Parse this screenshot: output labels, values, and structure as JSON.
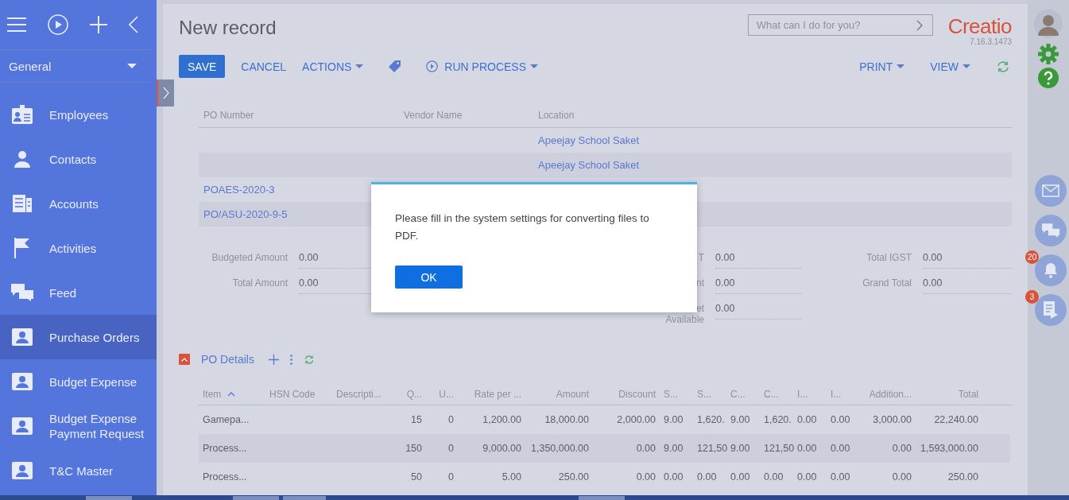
{
  "sidebar": {
    "section": "General",
    "items": [
      {
        "label": "Employees",
        "kind": "badge",
        "selected": false
      },
      {
        "label": "Contacts",
        "kind": "person",
        "selected": false
      },
      {
        "label": "Accounts",
        "kind": "building",
        "selected": false
      },
      {
        "label": "Activities",
        "kind": "flag",
        "selected": false
      },
      {
        "label": "Feed",
        "kind": "chat",
        "selected": false
      },
      {
        "label": "Purchase Orders",
        "kind": "card",
        "selected": true
      },
      {
        "label": "Budget Expense",
        "kind": "card",
        "selected": false
      },
      {
        "label": "Budget Expense Payment Request",
        "kind": "card",
        "selected": false
      },
      {
        "label": "T&C Master",
        "kind": "card",
        "selected": false
      }
    ]
  },
  "page": {
    "title": "New record",
    "search": {
      "placeholder": "What can I do for you?"
    },
    "logo": "Creatio",
    "version": "7.16.3.1473"
  },
  "toolbar": {
    "left": [
      {
        "label": "SAVE",
        "kind": "primary"
      },
      {
        "label": "CANCEL",
        "kind": "link"
      },
      {
        "label": "ACTIONS",
        "kind": "menu"
      },
      {
        "kind": "tag"
      },
      {
        "label": "RUN PROCESS",
        "kind": "process"
      }
    ],
    "right": [
      {
        "label": "PRINT",
        "kind": "menu"
      },
      {
        "label": "VIEW",
        "kind": "menu"
      },
      {
        "kind": "refresh"
      }
    ]
  },
  "records": {
    "columns": [
      "PO Number",
      "Vendor Name",
      "Location"
    ],
    "rows": [
      {
        "location": "Apeejay School Saket"
      },
      {
        "location": "Apeejay School Saket"
      },
      {
        "po_number": "POAES-2020-3"
      },
      {
        "po_number": "PO/ASU-2020-9-5"
      }
    ]
  },
  "fields": [
    [
      {
        "label": "Budgeted Amount",
        "value": "0.00"
      },
      {
        "label": "Total Amount",
        "value": "0.00"
      }
    ],
    [
      {
        "label": "T",
        "value": "0.00"
      },
      {
        "label": "nt",
        "value": "0.00"
      },
      {
        "label": "et\nAvailable",
        "value": "0.00"
      }
    ],
    [
      {
        "label": "Total IGST",
        "value": "0.00"
      },
      {
        "label": "Grand Total",
        "value": "0.00"
      }
    ]
  ],
  "details": {
    "title": "PO Details",
    "expanded": true,
    "columns": [
      {
        "label": "Item",
        "sorted": true
      },
      {
        "label": "HSN Code",
        "sorted": false
      },
      {
        "label": "Descripti...",
        "sorted": false
      },
      {
        "label": "Q...",
        "sorted": false
      },
      {
        "label": "U...",
        "sorted": false
      },
      {
        "label": "Rate per ...",
        "sorted": false
      },
      {
        "label": "Amount",
        "sorted": false
      },
      {
        "label": "Discount",
        "sorted": false
      },
      {
        "label": "S...",
        "sorted": false
      },
      {
        "label": "S...",
        "sorted": false
      },
      {
        "label": "C...",
        "sorted": false
      },
      {
        "label": "C...",
        "sorted": false
      },
      {
        "label": "I...",
        "sorted": false
      },
      {
        "label": "I...",
        "sorted": false
      },
      {
        "label": "Addition...",
        "sorted": false
      },
      {
        "label": "Total",
        "sorted": false
      }
    ],
    "rows": [
      [
        "Gamepa...",
        "",
        "",
        "15",
        "0",
        "1,200.00",
        "18,000.00",
        "2,000.00",
        "9.00",
        "1,620.",
        "9.00",
        "1,620.",
        "0.00",
        "0.00",
        "3,000.00",
        "22,240.00"
      ],
      [
        "Process...",
        "",
        "",
        "150",
        "0",
        "9,000.00",
        "1,350,000.00",
        "0.00",
        "9.00",
        "121,50",
        "9.00",
        "121,50",
        "0.00",
        "0.00",
        "0.00",
        "1,593,000.00"
      ],
      [
        "Process...",
        "",
        "",
        "50",
        "0",
        "5.00",
        "250.00",
        "0.00",
        "0.00",
        "0.00",
        "0.00",
        "0.00",
        "0.00",
        "0.00",
        "0.00",
        "250.00"
      ]
    ]
  },
  "rail": [
    {
      "kind": "mail"
    },
    {
      "kind": "chat"
    },
    {
      "kind": "bell",
      "badge": "20"
    },
    {
      "kind": "feed",
      "badge": "3"
    }
  ],
  "dialog": {
    "message": "Please fill in the system settings for converting files to PDF.",
    "button": "OK"
  }
}
